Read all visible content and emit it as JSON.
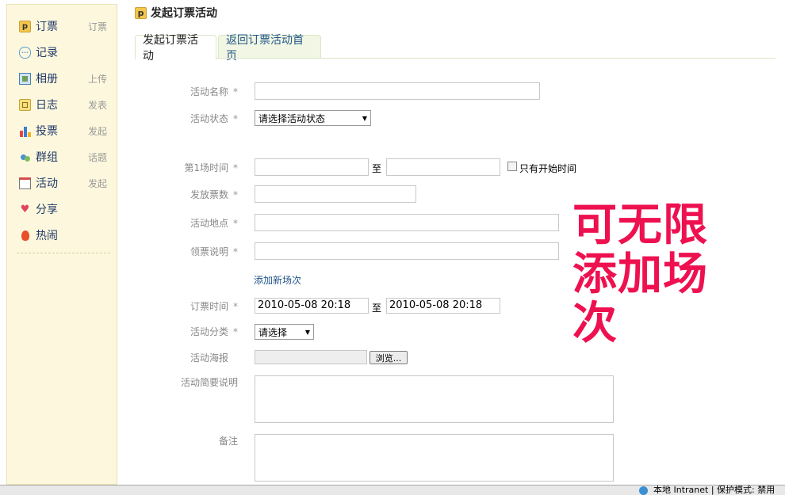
{
  "sidebar": {
    "items": [
      {
        "label": "订票",
        "extra": "订票",
        "icon": "ticket-icon"
      },
      {
        "label": "记录",
        "extra": "",
        "icon": "speech-bubble-icon"
      },
      {
        "label": "相册",
        "extra": "上传",
        "icon": "photo-icon"
      },
      {
        "label": "日志",
        "extra": "发表",
        "icon": "notebook-icon"
      },
      {
        "label": "投票",
        "extra": "发起",
        "icon": "bar-chart-icon"
      },
      {
        "label": "群组",
        "extra": "话题",
        "icon": "group-icon"
      },
      {
        "label": "活动",
        "extra": "发起",
        "icon": "calendar-icon"
      },
      {
        "label": "分享",
        "extra": "",
        "icon": "hearts-icon"
      },
      {
        "label": "热闹",
        "extra": "",
        "icon": "flame-icon"
      }
    ]
  },
  "header": {
    "title": "发起订票活动",
    "icon": "ticket-icon",
    "icon_glyph": "p"
  },
  "tabs": [
    {
      "label": "发起订票活动",
      "active": true
    },
    {
      "label": "返回订票活动首页",
      "active": false
    }
  ],
  "form": {
    "name_label": "活动名称",
    "status_label": "活动状态",
    "status_value": "请选择活动状态",
    "session_time_label": "第1场时间",
    "to_text": "至",
    "only_start_label": "只有开始时间",
    "tickets_label": "发放票数",
    "location_label": "活动地点",
    "pickup_label": "领票说明",
    "add_session_link": "添加新场次",
    "booking_time_label": "订票时间",
    "booking_start": "2010-05-08 20:18",
    "booking_end": "2010-05-08 20:18",
    "category_label": "活动分类",
    "category_value": "请选择",
    "poster_label": "活动海报",
    "browse_label": "浏览...",
    "summary_label": "活动简要说明",
    "remark_label": "备注",
    "required_mark": "*"
  },
  "annotation": {
    "text": "可无限添加场次",
    "color": "#ee1150"
  },
  "statusbar": {
    "text": "本地 Intranet | 保护模式: 禁用"
  }
}
